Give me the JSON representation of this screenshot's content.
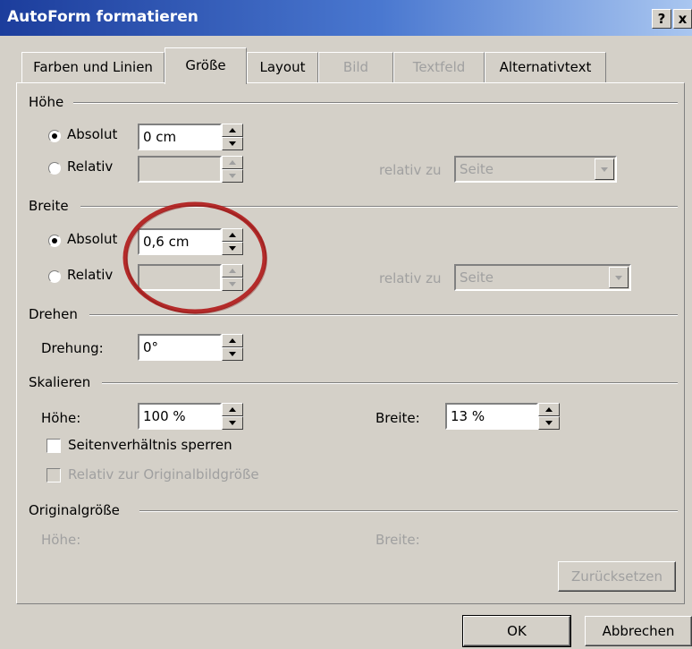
{
  "window": {
    "title": "AutoForm formatieren",
    "help_label": "?",
    "close_label": "x"
  },
  "tabs": [
    {
      "label": "Farben und Linien"
    },
    {
      "label": "Größe"
    },
    {
      "label": "Layout"
    },
    {
      "label": "Bild"
    },
    {
      "label": "Textfeld"
    },
    {
      "label": "Alternativtext"
    }
  ],
  "hoehe": {
    "section": "Höhe",
    "absolut_label": "Absolut",
    "absolut_value": "0 cm",
    "relativ_label": "Relativ",
    "relativ_value": "",
    "relativ_zu_label": "relativ zu",
    "relativ_zu_value": "Seite"
  },
  "breite": {
    "section": "Breite",
    "absolut_label": "Absolut",
    "absolut_value": "0,6 cm",
    "relativ_label": "Relativ",
    "relativ_value": "",
    "relativ_zu_label": "relativ zu",
    "relativ_zu_value": "Seite"
  },
  "drehen": {
    "section": "Drehen",
    "drehung_label": "Drehung:",
    "drehung_value": "0°"
  },
  "skalieren": {
    "section": "Skalieren",
    "hoehe_label": "Höhe:",
    "hoehe_value": "100 %",
    "breite_label": "Breite:",
    "breite_value": "13 %",
    "lock_label": "Seitenverhältnis sperren",
    "relative_label": "Relativ zur Originalbildgröße"
  },
  "original": {
    "section": "Originalgröße",
    "hoehe_label": "Höhe:",
    "breite_label": "Breite:",
    "reset_label": "Zurücksetzen"
  },
  "footer": {
    "ok_label": "OK",
    "cancel_label": "Abbrechen"
  },
  "annotation": {
    "color": "#b01818"
  }
}
